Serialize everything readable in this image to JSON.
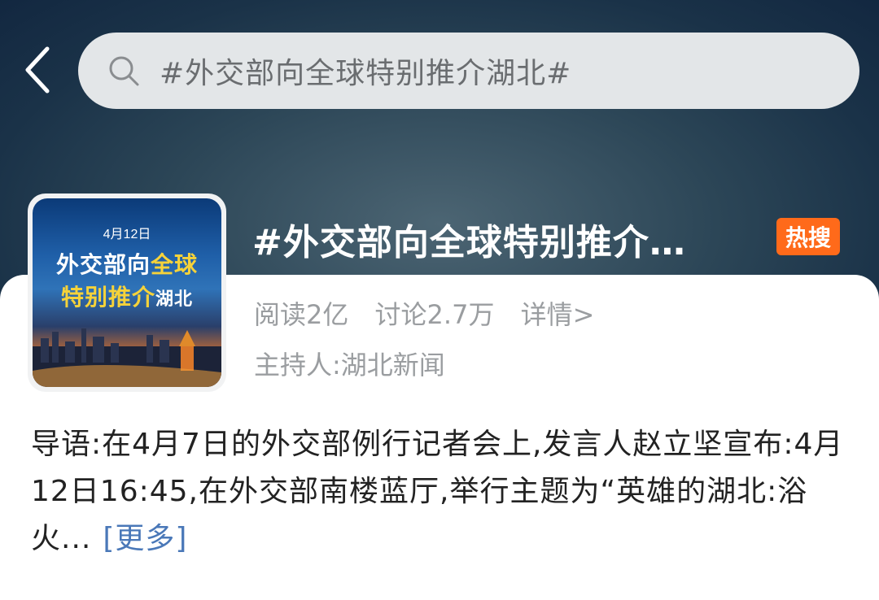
{
  "search": {
    "query": "#外交部向全球特别推介湖北#"
  },
  "thumbnail": {
    "date": "4月12日",
    "line1_a": "外交部向",
    "line1_b": "全球",
    "line2_a": "特别推介",
    "line2_b": "湖北"
  },
  "topic": {
    "title": "#外交部向全球特别推介…",
    "badge": "热搜",
    "read": "阅读2亿",
    "discuss": "讨论2.7万",
    "detail": "详情>",
    "host": "主持人:湖北新闻"
  },
  "intro": {
    "text": "导语:在4月7日的外交部例行记者会上,发言人赵立坚宣布:4月12日16:45,在外交部南楼蓝厅,举行主题为“英雄的湖北:浴火...",
    "more": "[更多]"
  },
  "colors": {
    "accent": "#4a78b8",
    "badge": "#ff6a1a",
    "header": "#1a3248"
  }
}
